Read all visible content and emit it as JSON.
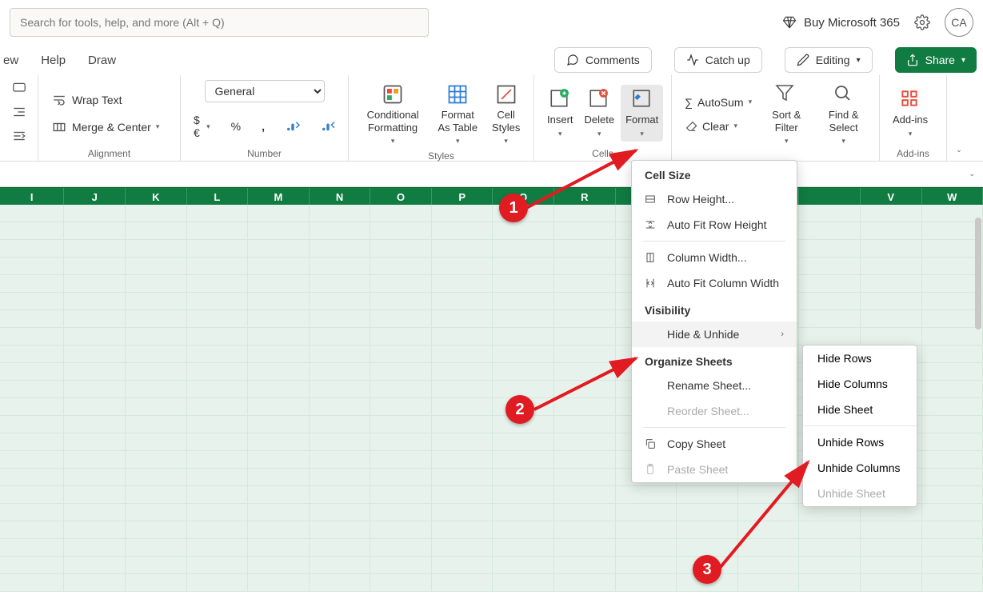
{
  "topbar": {
    "search_placeholder": "Search for tools, help, and more (Alt + Q)",
    "buy_label": "Buy Microsoft 365",
    "avatar_initials": "CA"
  },
  "tabs": {
    "left": [
      "ew",
      "Help",
      "Draw"
    ],
    "comments": "Comments",
    "catchup": "Catch up",
    "editing": "Editing",
    "share": "Share"
  },
  "ribbon": {
    "alignment": {
      "wrap": "Wrap Text",
      "merge": "Merge & Center",
      "label": "Alignment"
    },
    "number": {
      "format_selected": "General",
      "currency": "$€",
      "percent": "%",
      "comma": ",",
      "inc_dec": "",
      "label": "Number"
    },
    "styles": {
      "conditional": "Conditional Formatting",
      "table": "Format As Table",
      "cell": "Cell Styles",
      "label": "Styles"
    },
    "cells": {
      "insert": "Insert",
      "delete": "Delete",
      "format": "Format",
      "label": "Cells"
    },
    "editing": {
      "autosum": "AutoSum",
      "clear": "Clear",
      "sort": "Sort & Filter",
      "find": "Find & Select"
    },
    "addins": {
      "label": "Add-ins",
      "btn": "Add-ins"
    }
  },
  "columns": [
    "I",
    "J",
    "K",
    "L",
    "M",
    "N",
    "O",
    "P",
    "Q",
    "R",
    "",
    "",
    "",
    "",
    "V",
    "W"
  ],
  "format_menu": {
    "cell_size": "Cell Size",
    "row_height": "Row Height...",
    "autofit_row": "Auto Fit Row Height",
    "col_width": "Column Width...",
    "autofit_col": "Auto Fit Column Width",
    "visibility": "Visibility",
    "hide_unhide": "Hide & Unhide",
    "organize": "Organize Sheets",
    "rename": "Rename Sheet...",
    "reorder": "Reorder Sheet...",
    "copy": "Copy Sheet",
    "paste": "Paste Sheet"
  },
  "hide_submenu": {
    "hide_rows": "Hide Rows",
    "hide_cols": "Hide Columns",
    "hide_sheet": "Hide Sheet",
    "unhide_rows": "Unhide Rows",
    "unhide_cols": "Unhide Columns",
    "unhide_sheet": "Unhide Sheet"
  },
  "annotations": {
    "b1": "1",
    "b2": "2",
    "b3": "3"
  }
}
